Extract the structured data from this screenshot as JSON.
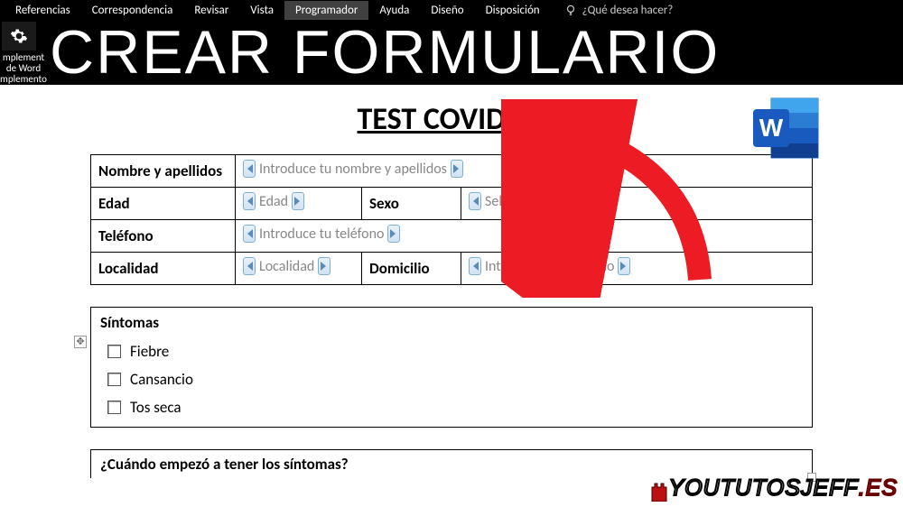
{
  "ribbon": {
    "tabs": [
      "Referencias",
      "Correspondencia",
      "Revisar",
      "Vista",
      "Programador",
      "Ayuda",
      "Diseño",
      "Disposición"
    ],
    "active_tab": "Programador",
    "tell_me": "¿Qué desea hacer?",
    "complemento_lines": [
      "mplement",
      "de Word",
      "mplemento"
    ]
  },
  "banner": "CREAR FORMULARIO",
  "doc": {
    "title": "TEST COVID-19",
    "fields": {
      "name_label": "Nombre y apellidos",
      "name_placeholder": "Introduce tu nombre y apellidos",
      "age_label": "Edad",
      "age_placeholder": "Edad",
      "sex_label": "Sexo",
      "sex_placeholder": "Selecciona tu sexo",
      "phone_label": "Teléfono",
      "phone_placeholder": "Introduce tu teléfono",
      "city_label": "Localidad",
      "city_placeholder": "Localidad",
      "address_label": "Domicilio",
      "address_placeholder": "Introduce tu domicilio"
    },
    "symptoms": {
      "heading": "Síntomas",
      "items": [
        "Fiebre",
        "Cansancio",
        "Tos seca"
      ]
    },
    "next_question": "¿Cuándo empezó a tener los síntomas?"
  },
  "watermark": {
    "main": "YOUTUTOSJEFF",
    "suffix": ".ES"
  }
}
